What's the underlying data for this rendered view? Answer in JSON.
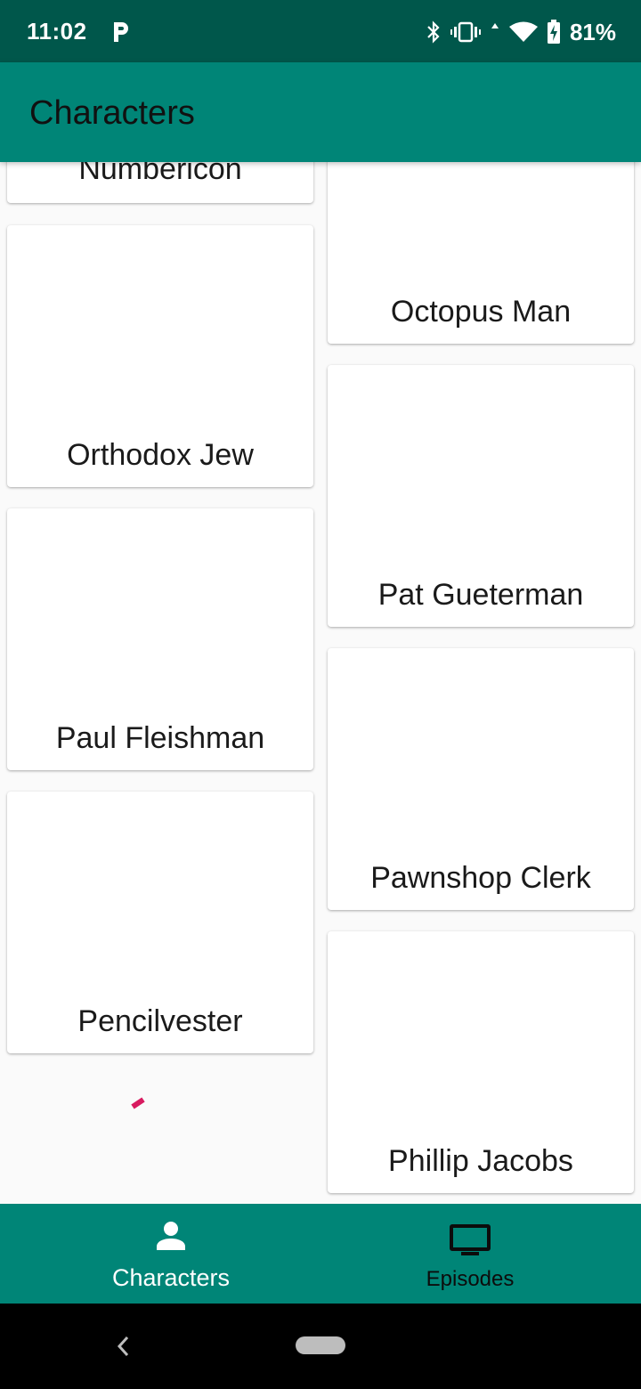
{
  "status_bar": {
    "time": "11:02",
    "battery": "81%"
  },
  "app_bar": {
    "title": "Characters"
  },
  "characters": [
    "Numbericon",
    "Octopus Man",
    "Orthodox Jew",
    "Pat Gueterman",
    "Paul Fleishman",
    "Pawnshop Clerk",
    "Pencilvester",
    "Phillip Jacobs"
  ],
  "bottom_nav": {
    "characters_label": "Characters",
    "episodes_label": "Episodes",
    "active": "Characters"
  },
  "colors": {
    "status_bar": "#00574b",
    "primary": "#008577",
    "accent": "#d81b60",
    "background": "#fafafa"
  }
}
